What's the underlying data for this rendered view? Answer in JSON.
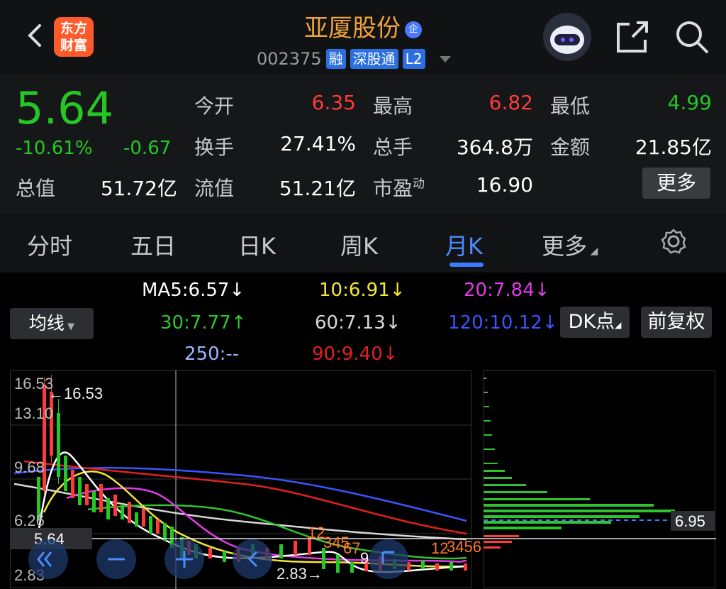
{
  "header": {
    "logo_line1": "东方",
    "logo_line2": "财富",
    "stock_name": "亚厦股份",
    "qi_badge": "企",
    "stock_code": "002375",
    "tags": [
      "融",
      "深股通",
      "L2"
    ]
  },
  "quote": {
    "price": "5.64",
    "change_pct": "-10.61%",
    "change_abs": "-0.67",
    "labels": {
      "open": "今开",
      "high": "最高",
      "low": "最低",
      "turnover": "换手",
      "volume": "总手",
      "amount": "金额",
      "total_mv": "总值",
      "float_mv": "流值",
      "pe": "市盈",
      "pe_sup": "动"
    },
    "values": {
      "open": "6.35",
      "high": "6.82",
      "low": "4.99",
      "turnover": "27.41%",
      "volume": "364.8万",
      "amount": "21.85亿",
      "total_mv": "51.72亿",
      "float_mv": "51.21亿",
      "pe": "16.90"
    },
    "more_button": "更多"
  },
  "tabs": [
    "分时",
    "五日",
    "日K",
    "周K",
    "月K",
    "更多"
  ],
  "active_tab": "月K",
  "ma": {
    "ma5": "MA5:6.57↓",
    "ma10": "10:6.91↓",
    "ma20": "20:7.84↓",
    "ma30": "30:7.77↑",
    "ma60": "60:7.13↓",
    "ma120": "120:10.12↓",
    "ma250": "250:--",
    "ma90": "90:9.40↓",
    "indicator_select": "均线",
    "dk_button": "DK点",
    "fq_button": "前复权"
  },
  "chart": {
    "y_labels": [
      "16.53",
      "13.10",
      "9.68",
      "6.26",
      "2.83"
    ],
    "max_marker": "16.53",
    "min_marker": "2.83",
    "current_price": "5.64",
    "vol_profile_price": "6.95",
    "signal_labels": [
      "12",
      "345",
      "67",
      "9",
      "12",
      "3456"
    ]
  },
  "colors": {
    "up": "#ff3a3a",
    "down": "#25c725",
    "accent": "#3b7cff",
    "ma5": "#ffffff",
    "ma10": "#f5e63b",
    "ma20": "#e13be8",
    "ma30": "#2fc42f",
    "ma60": "#d8d8d8",
    "ma120": "#3a55ff",
    "ma90": "#e02020"
  }
}
